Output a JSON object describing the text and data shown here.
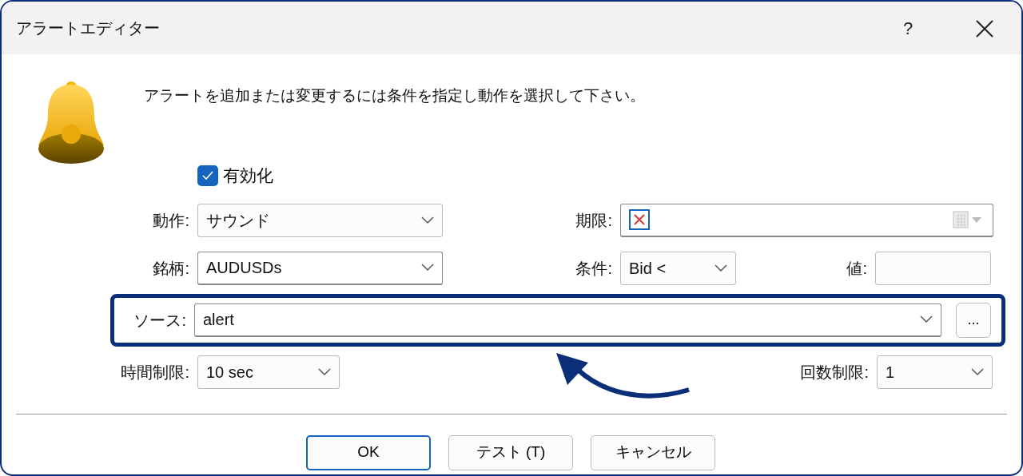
{
  "window": {
    "title": "アラートエディター",
    "help_button": "?"
  },
  "message": "アラートを追加または変更するには条件を指定し動作を選択して下さい。",
  "enable": {
    "label": "有効化",
    "checked": true
  },
  "rows": [
    {
      "highlighted": false,
      "fields": [
        {
          "label": "動作:",
          "kind": "combo",
          "value": "サウンド"
        },
        {
          "label": "期限:",
          "kind": "date",
          "checked": false
        }
      ]
    },
    {
      "highlighted": false,
      "fields": [
        {
          "label": "銘柄:",
          "kind": "combo",
          "value": "AUDUSDs"
        },
        {
          "label": "条件:",
          "kind": "combo",
          "value": "Bid <"
        },
        {
          "label": "値:",
          "kind": "text"
        }
      ]
    },
    {
      "highlighted": true,
      "fields": [
        {
          "label": "ソース:",
          "kind": "combo",
          "value": "alert",
          "button": "..."
        }
      ]
    },
    {
      "highlighted": false,
      "fields": [
        {
          "label": "時間制限:",
          "kind": "combo",
          "value": "10 sec"
        },
        {
          "label": "回数制限:",
          "kind": "combo",
          "value": "1"
        }
      ]
    }
  ],
  "buttons": [
    {
      "label": "OK",
      "default": true
    },
    {
      "label": "テスト (T)",
      "default": false
    },
    {
      "label": "キャンセル",
      "default": false
    }
  ]
}
